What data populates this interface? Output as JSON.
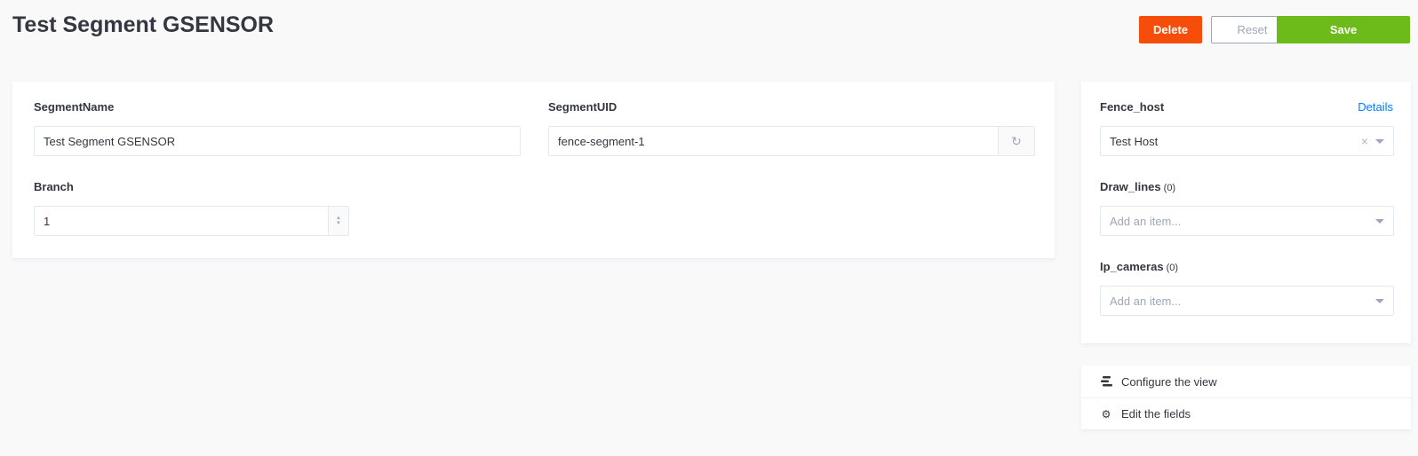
{
  "header": {
    "title": "Test Segment GSENSOR",
    "delete_label": "Delete",
    "reset_label": "Reset",
    "save_label": "Save"
  },
  "form": {
    "segment_name": {
      "label": "SegmentName",
      "value": "Test Segment GSENSOR"
    },
    "segment_uid": {
      "label": "SegmentUID",
      "value": "fence-segment-1"
    },
    "branch": {
      "label": "Branch",
      "value": "1"
    }
  },
  "relations": {
    "fence_host": {
      "label": "Fence_host",
      "details_label": "Details",
      "value": "Test Host"
    },
    "draw_lines": {
      "label": "Draw_lines",
      "count": "(0)",
      "placeholder": "Add an item..."
    },
    "ip_cameras": {
      "label": "Ip_cameras",
      "count": "(0)",
      "placeholder": "Add an item..."
    }
  },
  "links": {
    "configure_view": "Configure the view",
    "edit_fields": "Edit the fields"
  },
  "colors": {
    "delete": "#f64d0a",
    "save": "#6dbb1a",
    "link": "#007eff"
  }
}
